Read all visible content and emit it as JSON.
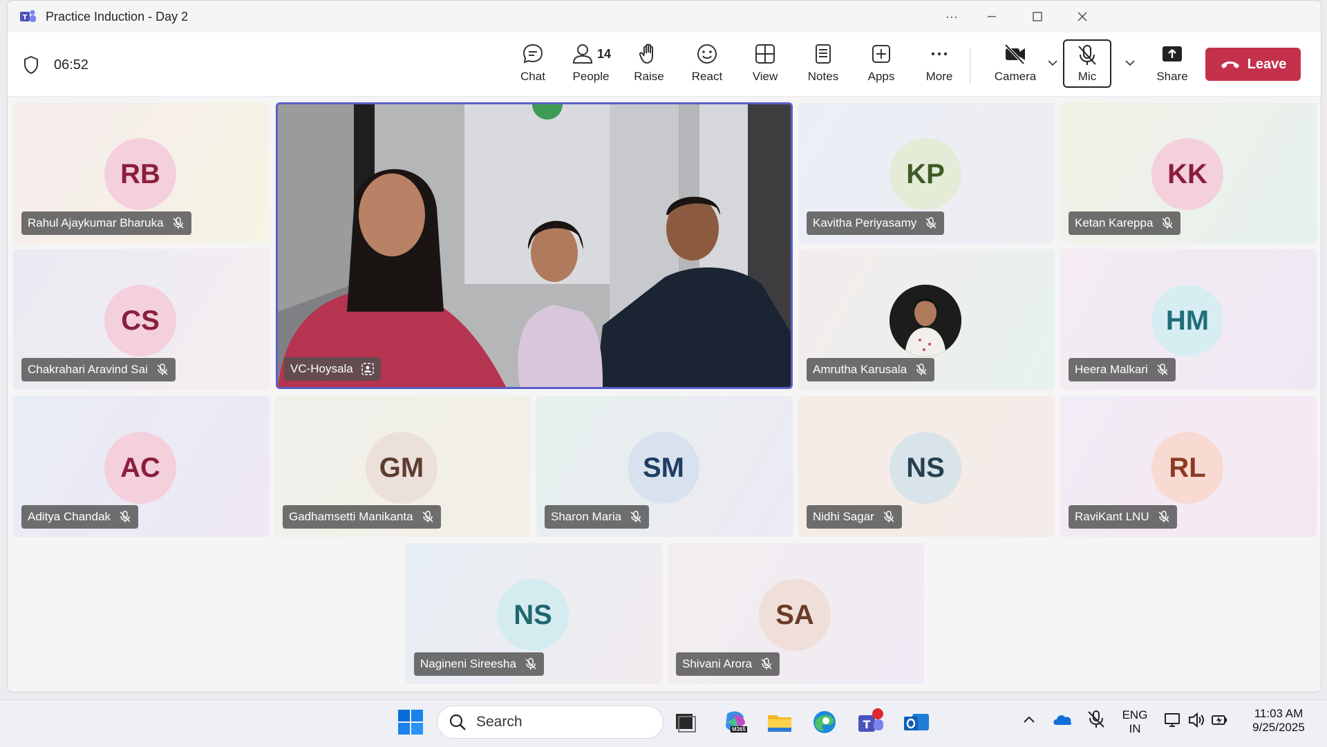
{
  "window": {
    "title": "Practice Induction - Day 2"
  },
  "meeting": {
    "timer": "06:52"
  },
  "toolbar": {
    "chat": "Chat",
    "people": "People",
    "people_count": "14",
    "raise": "Raise",
    "react": "React",
    "view": "View",
    "notes": "Notes",
    "apps": "Apps",
    "more": "More",
    "camera": "Camera",
    "mic": "Mic",
    "share": "Share",
    "leave": "Leave"
  },
  "participants": [
    {
      "initials": "RB",
      "name": "Rahul Ajaykumar Bharuka",
      "avatar_bg": "#f4cfdc",
      "avatar_fg": "#8a1f3d"
    },
    {
      "initials": "KP",
      "name": "Kavitha Periyasamy",
      "avatar_bg": "#e4ecd8",
      "avatar_fg": "#3f5a25"
    },
    {
      "initials": "KK",
      "name": "Ketan Kareppa",
      "avatar_bg": "#f4cfdc",
      "avatar_fg": "#8a1f3d"
    },
    {
      "initials": "CS",
      "name": "Chakrahari Aravind Sai",
      "avatar_bg": "#f4cfdc",
      "avatar_fg": "#8a1f3d"
    },
    {
      "initials": "",
      "name": "Amrutha Karusala",
      "avatar_bg": "#222",
      "avatar_fg": "#fff"
    },
    {
      "initials": "HM",
      "name": "Heera Malkari",
      "avatar_bg": "#d6edf2",
      "avatar_fg": "#1f6e7a"
    },
    {
      "initials": "AC",
      "name": "Aditya Chandak",
      "avatar_bg": "#f4cfdc",
      "avatar_fg": "#8a1f3d"
    },
    {
      "initials": "GM",
      "name": "Gadhamsetti Manikanta",
      "avatar_bg": "#ece0db",
      "avatar_fg": "#5e3c30"
    },
    {
      "initials": "SM",
      "name": "Sharon Maria",
      "avatar_bg": "#d8e2ee",
      "avatar_fg": "#1f3d62"
    },
    {
      "initials": "NS",
      "name": "Nidhi Sagar",
      "avatar_bg": "#d9e3ea",
      "avatar_fg": "#26404f"
    },
    {
      "initials": "RL",
      "name": "RaviKant LNU",
      "avatar_bg": "#f8dad2",
      "avatar_fg": "#8c3b22"
    },
    {
      "initials": "NS",
      "name": "Nagineni Sireesha",
      "avatar_bg": "#d4ecef",
      "avatar_fg": "#1f6670"
    },
    {
      "initials": "SA",
      "name": "Shivani Arora",
      "avatar_bg": "#efdfd8",
      "avatar_fg": "#6b3a28"
    }
  ],
  "video": {
    "name": "VC-Hoysala"
  },
  "taskbar": {
    "search_placeholder": "Search",
    "lang_top": "ENG",
    "lang_bottom": "IN",
    "time": "11:03 AM",
    "date": "9/25/2025",
    "m365_label": "M365"
  },
  "colors": {
    "accent": "#5b5fc7",
    "leave": "#c4314b"
  }
}
